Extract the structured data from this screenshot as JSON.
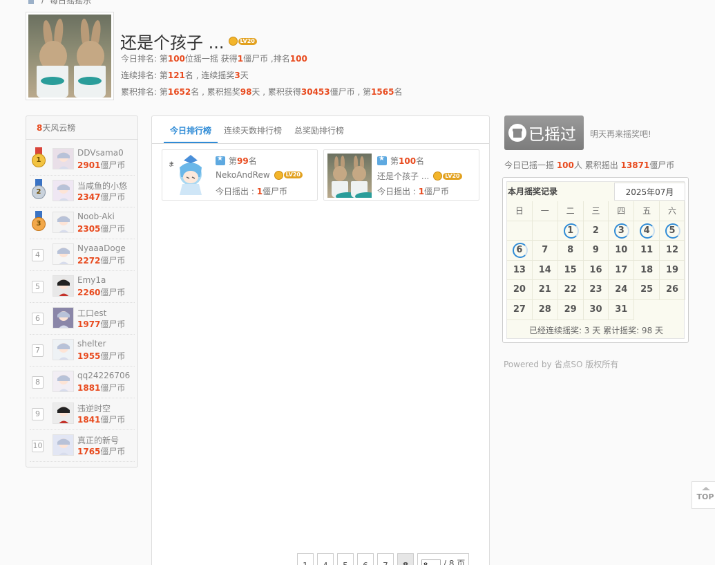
{
  "breadcrumb": {
    "current": "每日摇摇乐"
  },
  "profile": {
    "name": "还是个孩子 ...",
    "level": "LV20",
    "today": {
      "p1": "今日排名: 第",
      "rank": "100",
      "p2": "位摇一摇 获得",
      "coins": "1",
      "p3": "僵尸币 ,排名",
      "rank2": "100"
    },
    "streak": {
      "p1": "连续排名: 第",
      "rank": "121",
      "p2": "名 , 连续摇奖",
      "days": "3",
      "p3": "天"
    },
    "total": {
      "p1": "累积排名: 第",
      "rank": "1652",
      "p2": "名 , 累积摇奖",
      "days": "98",
      "p3": "天 , 累积获得",
      "coins": "30453",
      "p4": "僵尸币 , 第",
      "rank2": "1565",
      "p5": "名"
    }
  },
  "leaderboard": {
    "header_num": "8",
    "header_text": "天风云榜",
    "unit": "僵尸币",
    "items": [
      {
        "rank": "1",
        "name": "DDVsama0",
        "value": "2901"
      },
      {
        "rank": "2",
        "name": "当咸鱼的小悠",
        "value": "2347"
      },
      {
        "rank": "3",
        "name": "Noob-Aki",
        "value": "2305"
      },
      {
        "rank": "4",
        "name": "NyaaaDoge",
        "value": "2272"
      },
      {
        "rank": "5",
        "name": "Emy1a",
        "value": "2260"
      },
      {
        "rank": "6",
        "name": "工口est",
        "value": "1977"
      },
      {
        "rank": "7",
        "name": "shelter",
        "value": "1955"
      },
      {
        "rank": "8",
        "name": "qq24226706",
        "value": "1881"
      },
      {
        "rank": "9",
        "name": "违逆时空",
        "value": "1841"
      },
      {
        "rank": "10",
        "name": "真正的新号",
        "value": "1765"
      }
    ]
  },
  "tabs": [
    "今日排行榜",
    "连续天数排行榜",
    "总奖励排行榜"
  ],
  "cards": [
    {
      "rank_prefix": "第",
      "rank": "99",
      "rank_suffix": "名",
      "name": "NekoAndRew",
      "level": "LV20",
      "shake_label": "今日摇出 : ",
      "coins": "1",
      "unit": "僵尸币"
    },
    {
      "rank_prefix": "第",
      "rank": "100",
      "rank_suffix": "名",
      "name": "还是个孩子 ...",
      "level": "LV20",
      "shake_label": "今日摇出 : ",
      "coins": "1",
      "unit": "僵尸币"
    }
  ],
  "pager": {
    "pages": [
      "1",
      "4",
      "5",
      "6",
      "7",
      "8"
    ],
    "current": "8",
    "input_value": "8",
    "total": "/ 8 页"
  },
  "shake": {
    "button": "已摇过",
    "hint": "明天再来摇奖吧!"
  },
  "today_summary": {
    "p1": "今日已摇一摇 ",
    "people": "100",
    "p2": "人 累积摇出 ",
    "coins": "13871",
    "p3": "僵尸币"
  },
  "calendar": {
    "title": "本月摇奖记录",
    "month": "2025年07月",
    "weekdays": [
      "日",
      "一",
      "二",
      "三",
      "四",
      "五",
      "六"
    ],
    "leading_blanks": 2,
    "days": 31,
    "marked": [
      1,
      3,
      4,
      5,
      6
    ],
    "footer": "已经连续摇奖:  3 天  累计摇奖:  98 天"
  },
  "footer": {
    "powered": "Powered by 省点SO 版权所有"
  },
  "top_button": "TOP"
}
